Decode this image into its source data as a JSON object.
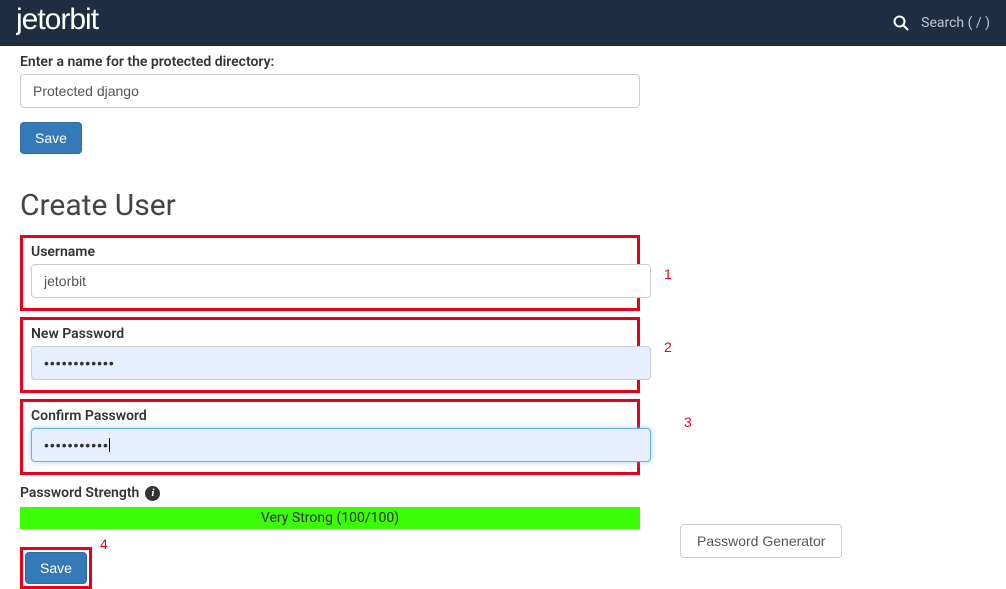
{
  "navbar": {
    "logo": "jetorbit",
    "search_label": "Search ( / )"
  },
  "protected": {
    "label": "Enter a name for the protected directory:",
    "value": "Protected django",
    "save_label": "Save"
  },
  "create_user": {
    "heading": "Create User",
    "username_label": "Username",
    "username_value": "jetorbit",
    "new_password_label": "New Password",
    "new_password_value": "••••••••••••",
    "confirm_password_label": "Confirm Password",
    "confirm_password_value": "•••••••••••",
    "strength_label": "Password Strength",
    "strength_text": "Very Strong (100/100)",
    "generator_label": "Password Generator",
    "save_label": "Save"
  },
  "annotations": {
    "a1": "1",
    "a2": "2",
    "a3": "3",
    "a4": "4"
  }
}
